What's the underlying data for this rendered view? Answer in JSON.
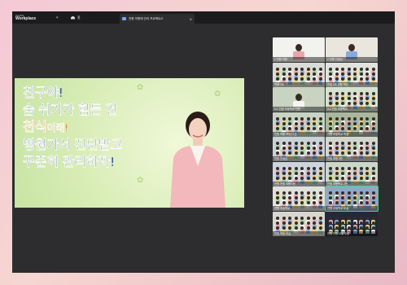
{
  "app": {
    "brand_small": "NAVER",
    "brand_big": "Workplace"
  },
  "nav": {
    "home_label": "홈"
  },
  "tab": {
    "label": "천원 의원에 관리 프로젝트/2"
  },
  "slide": {
    "lines": [
      "친구야!",
      "숨 쉬기가 힘든 건",
      "천식",
      "이래!",
      "병원가서 진단받고",
      "꾸준히 관리하자!"
    ]
  },
  "participants": [
    {
      "name": "1 천원 의원"
    },
    {
      "name": "2 천원 선생님"
    },
    {
      "name": "학생 1조"
    },
    {
      "name": "천원 1조 천원 학년"
    },
    {
      "name": "5-1 천원 초등학교 천원"
    },
    {
      "name": "4-2 천원 초등학교"
    },
    {
      "name": "천원 초등 3학년 1반"
    },
    {
      "name": "천원 초등학교 학생"
    },
    {
      "name": "천원 선생님"
    },
    {
      "name": "천원 초등 2반"
    },
    {
      "name": "천원 천원 초등 1반"
    },
    {
      "name": "천원 초등학교 2반"
    },
    {
      "name": "천원 초등학교"
    },
    {
      "name": "천원 초등학교 교실"
    },
    {
      "name": "천원 초등 교실"
    },
    {
      "name": "천원 천원 교실 수업"
    }
  ]
}
